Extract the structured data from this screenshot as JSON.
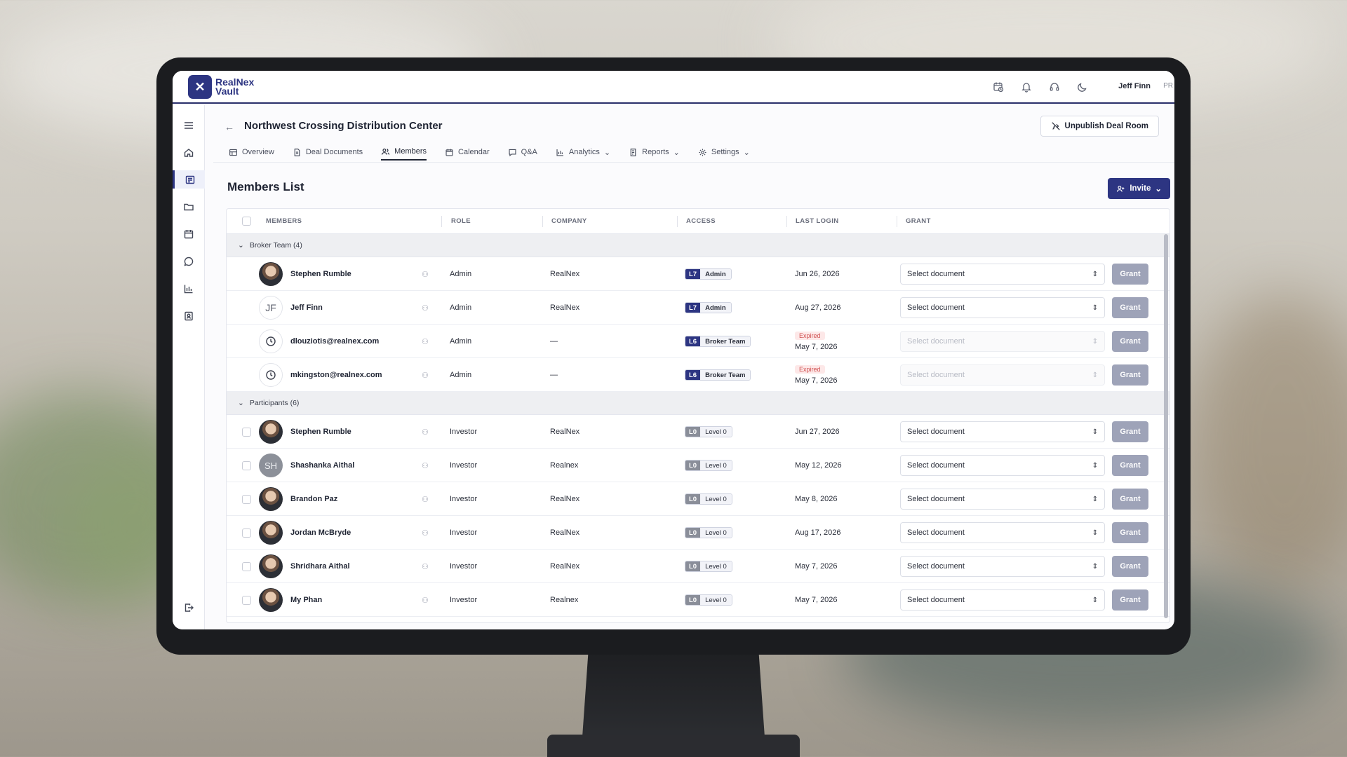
{
  "app": {
    "logo_line1": "RealNex",
    "logo_line2": "Vault",
    "logo_mark": "✕",
    "user_name": "Jeff Finn",
    "user_initials": "PR"
  },
  "deal": {
    "title": "Northwest Crossing Distribution Center",
    "unpublish_label": "Unpublish Deal Room"
  },
  "tabs": [
    {
      "label": "Overview",
      "icon": "overview-icon"
    },
    {
      "label": "Deal Documents",
      "icon": "document-icon"
    },
    {
      "label": "Members",
      "icon": "users-icon"
    },
    {
      "label": "Calendar",
      "icon": "calendar-icon"
    },
    {
      "label": "Q&A",
      "icon": "chat-icon"
    },
    {
      "label": "Analytics",
      "icon": "bar-chart-icon"
    },
    {
      "label": "Reports",
      "icon": "report-icon"
    },
    {
      "label": "Settings",
      "icon": "gear-icon"
    }
  ],
  "members_list": {
    "title": "Members List",
    "invite_label": "Invite"
  },
  "columns": {
    "members": "MEMBERS",
    "role": "ROLE",
    "company": "COMPANY",
    "access": "ACCESS",
    "last_login": "LAST LOGIN",
    "grant": "GRANT"
  },
  "groups": {
    "broker": "Broker Team (4)",
    "participants": "Participants (6)"
  },
  "select_placeholder": "Select document",
  "grant_label": "Grant",
  "expired_label": "Expired",
  "broker_rows": [
    {
      "name": "Stephen Rumble",
      "role": "Admin",
      "company": "RealNex",
      "level": "L7",
      "level_name": "Admin",
      "last_login": "Jun 26, 2026"
    },
    {
      "name": "Jeff Finn",
      "initials": "JF",
      "role": "Admin",
      "company": "RealNex",
      "level": "L7",
      "level_name": "Admin",
      "last_login": "Aug 27, 2026"
    },
    {
      "name": "dlouziotis@realnex.com",
      "role": "Admin",
      "company": "—",
      "level": "L6",
      "level_name": "Broker Team",
      "last_login": "May 7, 2026"
    },
    {
      "name": "mkingston@realnex.com",
      "role": "Admin",
      "company": "—",
      "level": "L6",
      "level_name": "Broker Team",
      "last_login": "May 7, 2026"
    }
  ],
  "participant_rows": [
    {
      "name": "Stephen Rumble",
      "role": "Investor",
      "company": "RealNex",
      "level": "L0",
      "level_name": "Level 0",
      "last_login": "Jun 27, 2026"
    },
    {
      "name": "Shashanka Aithal",
      "initials": "SH",
      "role": "Investor",
      "company": "Realnex",
      "level": "L0",
      "level_name": "Level 0",
      "last_login": "May 12, 2026"
    },
    {
      "name": "Brandon Paz",
      "role": "Investor",
      "company": "RealNex",
      "level": "L0",
      "level_name": "Level 0",
      "last_login": "May 8, 2026"
    },
    {
      "name": "Jordan McBryde",
      "role": "Investor",
      "company": "RealNex",
      "level": "L0",
      "level_name": "Level 0",
      "last_login": "Aug 17, 2026"
    },
    {
      "name": "Shridhara Aithal",
      "role": "Investor",
      "company": "RealNex",
      "level": "L0",
      "level_name": "Level 0",
      "last_login": "May 7, 2026"
    },
    {
      "name": "My Phan",
      "role": "Investor",
      "company": "Realnex",
      "level": "L0",
      "level_name": "Level 0",
      "last_login": "May 7, 2026"
    }
  ],
  "colors": {
    "brand": "#2d3582",
    "grant_button": "#9ea3b8",
    "expired": "#d05050"
  }
}
